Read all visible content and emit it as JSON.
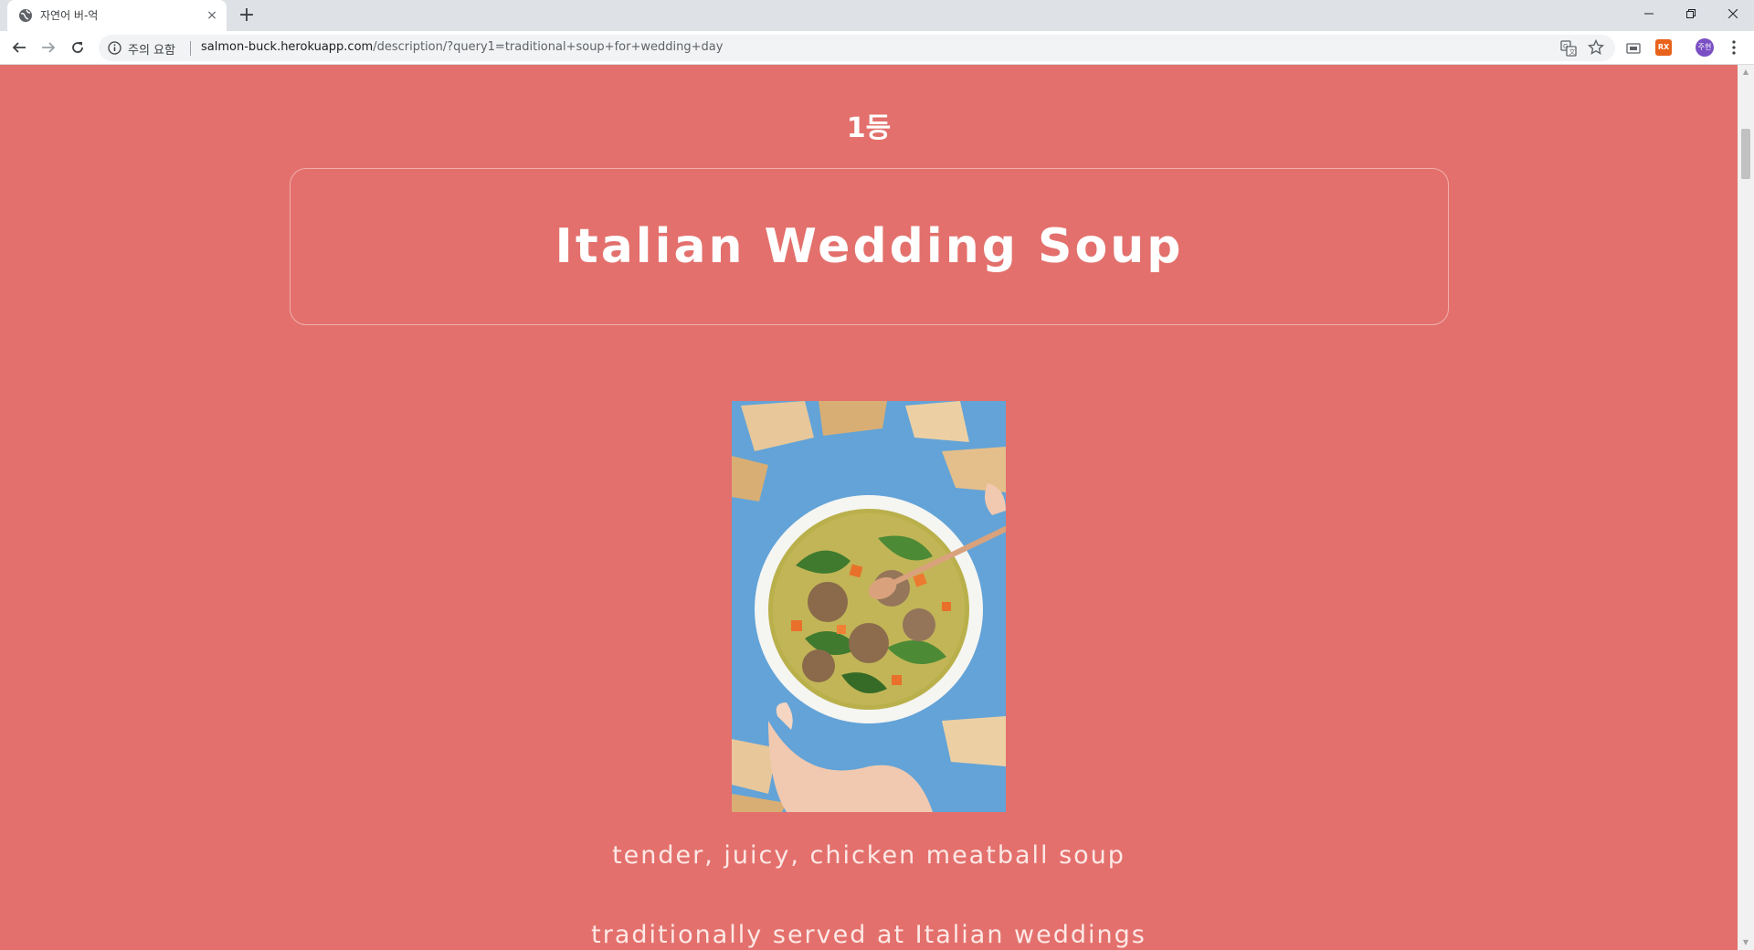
{
  "browser": {
    "tab_title": "자연어 버-억",
    "tab_close": "×",
    "new_tab": "+",
    "security_label": "주의 요함",
    "url_host": "salmon-buck.herokuapp.com",
    "url_path": "/description/?query1=traditional+soup+for+wedding+day",
    "profile_label": "주현",
    "extension_label": "RX"
  },
  "page": {
    "rank": "1등",
    "title": "Italian Wedding Soup",
    "descriptions": [
      "tender, juicy, chicken meatball soup",
      "traditionally served at Italian weddings"
    ]
  },
  "icons": {
    "favicon": "globe-icon",
    "back": "arrow-left-icon",
    "forward": "arrow-right-icon",
    "reload": "reload-icon",
    "info": "info-icon",
    "translate": "translate-icon",
    "bookmark": "star-icon",
    "menu": "more-vert-icon"
  },
  "colors": {
    "page_background": "#e3706c",
    "heading_text": "#ffffff",
    "description_text": "#fde8e6"
  }
}
